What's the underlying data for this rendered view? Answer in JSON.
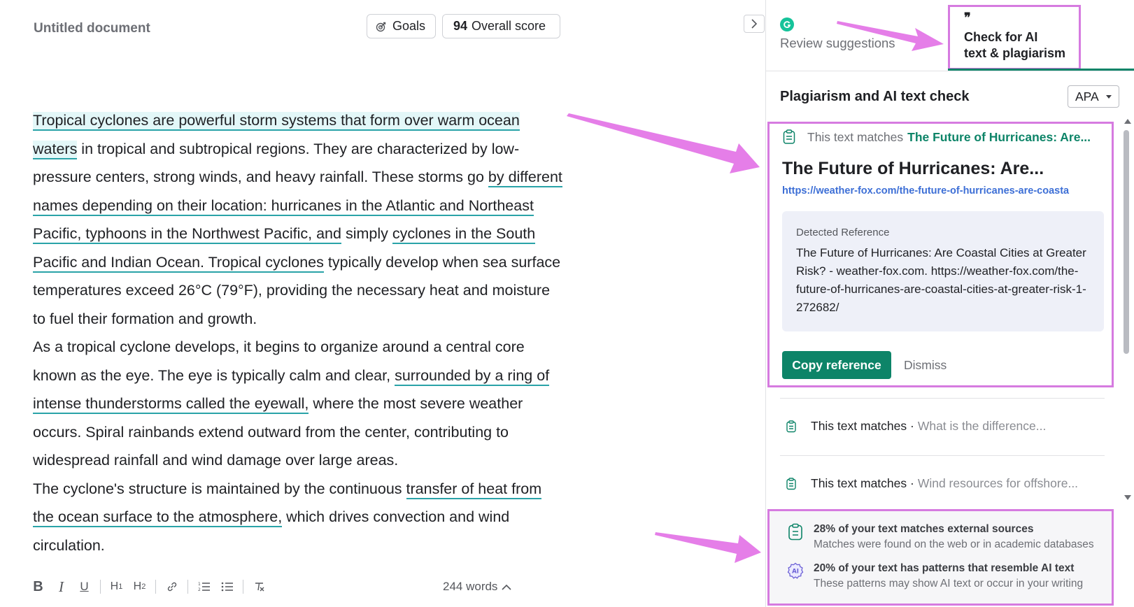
{
  "document": {
    "title": "Untitled document",
    "goals_label": "Goals",
    "score_value": "94",
    "score_label": "Overall score",
    "paragraphs": {
      "p1": {
        "a": "Tropical cyclones are powerful storm systems that form over warm ocean waters",
        "b": " in tropical and subtropical regions. They are characterized by low-pressure centers, strong winds, and heavy rainfall. These storms go ",
        "c": "by different names depending on their location: hurricanes in the Atlantic and Northeast Pacific, typhoons in the Northwest Pacific, and",
        "d": " simply ",
        "e": "cyclones in the South Pacific and Indian Ocean. Tropical cyclones",
        "f": " typically develop when sea surface temperatures exceed 26°C (79°F), providing the necessary heat and moisture to fuel their formation and growth."
      },
      "p2": {
        "a": "As a tropical cyclone develops, it begins to organize around a central core known as the eye. The eye is typically calm and clear, ",
        "b": "surrounded by a ring of intense thunderstorms called the eyewall,",
        "c": " where the most severe weather occurs. Spiral rainbands extend outward from the center, contributing to widespread rainfall and wind damage over large areas."
      },
      "p3": {
        "a": "The cyclone's structure is maintained by the continuous ",
        "b": "transfer of heat from the ocean surface to the atmosphere,",
        "c": " which drives convection and wind circulation."
      }
    },
    "toolbar": {
      "bold": "B",
      "italic": "I",
      "underline": "U",
      "h1": "H",
      "h1_sub": "1",
      "h2": "H",
      "h2_sub": "2"
    },
    "word_count": "244 words"
  },
  "panel": {
    "tab_review_label": "Review suggestions",
    "tab_ai_label_line1": "Check for AI",
    "tab_ai_label_line2": "text & plagiarism",
    "heading": "Plagiarism and AI text check",
    "citation_style": "APA",
    "active_match": {
      "prefix": "This text matches",
      "source_short": "The Future of Hurricanes: Are...",
      "title": "The Future of Hurricanes: Are...",
      "url": "https://weather-fox.com/the-future-of-hurricanes-are-coasta",
      "reference_label": "Detected Reference",
      "reference_text": "The Future of Hurricanes: Are Coastal Cities at Greater Risk? - weather-fox.com. https://weather-fox.com/the-future-of-hurricanes-are-coastal-cities-at-greater-risk-1-272682/",
      "copy_label": "Copy reference",
      "dismiss_label": "Dismiss"
    },
    "other_matches": [
      {
        "prefix": "This text matches ·",
        "source": "What is the difference..."
      },
      {
        "prefix": "This text matches ·",
        "source": "Wind resources for offshore..."
      }
    ],
    "summary": {
      "plagiarism_heading": "28% of your text matches external sources",
      "plagiarism_detail": "Matches were found on the web or in academic databases",
      "ai_heading": "20% of your text has patterns that resemble AI text",
      "ai_detail": "These patterns may show AI text or occur in your writing",
      "ai_badge": "AI"
    }
  },
  "colors": {
    "accent_green": "#0d8468",
    "underline_teal": "#2aa3a8",
    "highlight": "#e3f7f8",
    "annotation_magenta": "#d67be0",
    "link_blue": "#3d6fd6"
  },
  "icons": {
    "goals": "target-icon",
    "collapse": "chevron-right-icon",
    "match": "clipboard-icon",
    "ai": "ai-badge-icon"
  }
}
